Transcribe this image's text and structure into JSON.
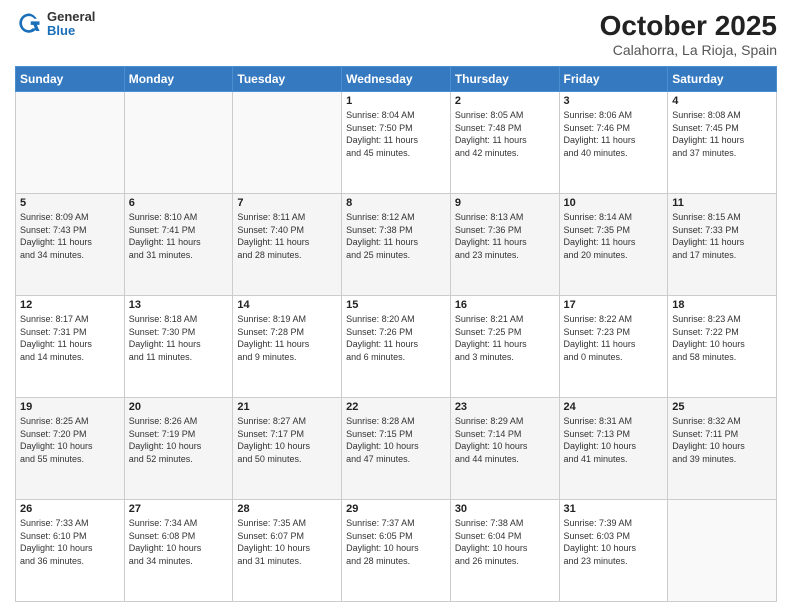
{
  "header": {
    "logo": {
      "general": "General",
      "blue": "Blue"
    },
    "title": "October 2025",
    "location": "Calahorra, La Rioja, Spain"
  },
  "days_of_week": [
    "Sunday",
    "Monday",
    "Tuesday",
    "Wednesday",
    "Thursday",
    "Friday",
    "Saturday"
  ],
  "weeks": [
    [
      {
        "day": "",
        "info": ""
      },
      {
        "day": "",
        "info": ""
      },
      {
        "day": "",
        "info": ""
      },
      {
        "day": "1",
        "info": "Sunrise: 8:04 AM\nSunset: 7:50 PM\nDaylight: 11 hours\nand 45 minutes."
      },
      {
        "day": "2",
        "info": "Sunrise: 8:05 AM\nSunset: 7:48 PM\nDaylight: 11 hours\nand 42 minutes."
      },
      {
        "day": "3",
        "info": "Sunrise: 8:06 AM\nSunset: 7:46 PM\nDaylight: 11 hours\nand 40 minutes."
      },
      {
        "day": "4",
        "info": "Sunrise: 8:08 AM\nSunset: 7:45 PM\nDaylight: 11 hours\nand 37 minutes."
      }
    ],
    [
      {
        "day": "5",
        "info": "Sunrise: 8:09 AM\nSunset: 7:43 PM\nDaylight: 11 hours\nand 34 minutes."
      },
      {
        "day": "6",
        "info": "Sunrise: 8:10 AM\nSunset: 7:41 PM\nDaylight: 11 hours\nand 31 minutes."
      },
      {
        "day": "7",
        "info": "Sunrise: 8:11 AM\nSunset: 7:40 PM\nDaylight: 11 hours\nand 28 minutes."
      },
      {
        "day": "8",
        "info": "Sunrise: 8:12 AM\nSunset: 7:38 PM\nDaylight: 11 hours\nand 25 minutes."
      },
      {
        "day": "9",
        "info": "Sunrise: 8:13 AM\nSunset: 7:36 PM\nDaylight: 11 hours\nand 23 minutes."
      },
      {
        "day": "10",
        "info": "Sunrise: 8:14 AM\nSunset: 7:35 PM\nDaylight: 11 hours\nand 20 minutes."
      },
      {
        "day": "11",
        "info": "Sunrise: 8:15 AM\nSunset: 7:33 PM\nDaylight: 11 hours\nand 17 minutes."
      }
    ],
    [
      {
        "day": "12",
        "info": "Sunrise: 8:17 AM\nSunset: 7:31 PM\nDaylight: 11 hours\nand 14 minutes."
      },
      {
        "day": "13",
        "info": "Sunrise: 8:18 AM\nSunset: 7:30 PM\nDaylight: 11 hours\nand 11 minutes."
      },
      {
        "day": "14",
        "info": "Sunrise: 8:19 AM\nSunset: 7:28 PM\nDaylight: 11 hours\nand 9 minutes."
      },
      {
        "day": "15",
        "info": "Sunrise: 8:20 AM\nSunset: 7:26 PM\nDaylight: 11 hours\nand 6 minutes."
      },
      {
        "day": "16",
        "info": "Sunrise: 8:21 AM\nSunset: 7:25 PM\nDaylight: 11 hours\nand 3 minutes."
      },
      {
        "day": "17",
        "info": "Sunrise: 8:22 AM\nSunset: 7:23 PM\nDaylight: 11 hours\nand 0 minutes."
      },
      {
        "day": "18",
        "info": "Sunrise: 8:23 AM\nSunset: 7:22 PM\nDaylight: 10 hours\nand 58 minutes."
      }
    ],
    [
      {
        "day": "19",
        "info": "Sunrise: 8:25 AM\nSunset: 7:20 PM\nDaylight: 10 hours\nand 55 minutes."
      },
      {
        "day": "20",
        "info": "Sunrise: 8:26 AM\nSunset: 7:19 PM\nDaylight: 10 hours\nand 52 minutes."
      },
      {
        "day": "21",
        "info": "Sunrise: 8:27 AM\nSunset: 7:17 PM\nDaylight: 10 hours\nand 50 minutes."
      },
      {
        "day": "22",
        "info": "Sunrise: 8:28 AM\nSunset: 7:15 PM\nDaylight: 10 hours\nand 47 minutes."
      },
      {
        "day": "23",
        "info": "Sunrise: 8:29 AM\nSunset: 7:14 PM\nDaylight: 10 hours\nand 44 minutes."
      },
      {
        "day": "24",
        "info": "Sunrise: 8:31 AM\nSunset: 7:13 PM\nDaylight: 10 hours\nand 41 minutes."
      },
      {
        "day": "25",
        "info": "Sunrise: 8:32 AM\nSunset: 7:11 PM\nDaylight: 10 hours\nand 39 minutes."
      }
    ],
    [
      {
        "day": "26",
        "info": "Sunrise: 7:33 AM\nSunset: 6:10 PM\nDaylight: 10 hours\nand 36 minutes."
      },
      {
        "day": "27",
        "info": "Sunrise: 7:34 AM\nSunset: 6:08 PM\nDaylight: 10 hours\nand 34 minutes."
      },
      {
        "day": "28",
        "info": "Sunrise: 7:35 AM\nSunset: 6:07 PM\nDaylight: 10 hours\nand 31 minutes."
      },
      {
        "day": "29",
        "info": "Sunrise: 7:37 AM\nSunset: 6:05 PM\nDaylight: 10 hours\nand 28 minutes."
      },
      {
        "day": "30",
        "info": "Sunrise: 7:38 AM\nSunset: 6:04 PM\nDaylight: 10 hours\nand 26 minutes."
      },
      {
        "day": "31",
        "info": "Sunrise: 7:39 AM\nSunset: 6:03 PM\nDaylight: 10 hours\nand 23 minutes."
      },
      {
        "day": "",
        "info": ""
      }
    ]
  ]
}
